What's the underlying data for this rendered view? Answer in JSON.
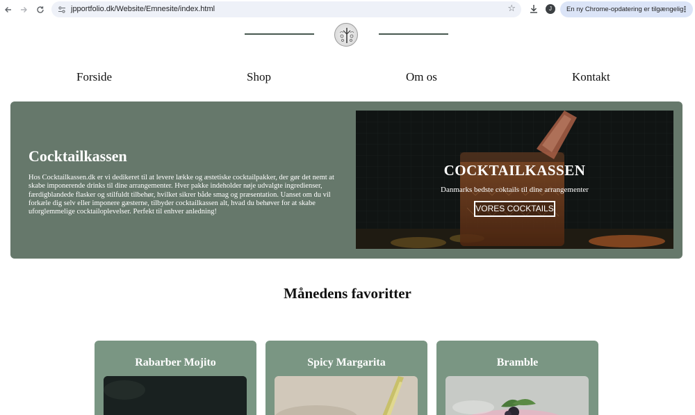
{
  "browser": {
    "url": "jpportfolio.dk/Website/Emnesite/index.html",
    "avatar_letter": "J",
    "update_notice": "En ny Chrome-opdatering er tilgængelig",
    "icons": [
      "back-arrow-icon",
      "forward-arrow-icon",
      "reload-icon",
      "site-info-icon",
      "bookmark-star-icon",
      "download-icon",
      "kebab-menu-icon"
    ]
  },
  "nav": {
    "items": [
      "Forside",
      "Shop",
      "Om os",
      "Kontakt"
    ]
  },
  "hero": {
    "title": "Cocktailkassen",
    "text": "Hos Cocktailkassen.dk er vi dedikeret til at levere lække og æstetiske cocktailpakker, der gør det nemt at skabe imponerende drinks til dine arrangementer. Hver pakke indeholder nøje udvalgte ingredienser, færdigblandede flasker og stilfuldt tilbehør, hvilket sikrer både smag og præsentation. Uanset om du vil forkæle dig selv eller imponere gæsterne, tilbyder cocktailkassen alt, hvad du behøver for at skabe uforglemmelige cocktailoplevelser. Perfekt til enhver anledning!",
    "banner_title": "COCKTAILKASSEN",
    "banner_subtitle": "Danmarks bedste coktails til dine arrangementer",
    "banner_button": "VORES COCKTAILS"
  },
  "favorites": {
    "title": "Månedens favoritter",
    "cards": [
      {
        "name": "Rabarber Mojito"
      },
      {
        "name": "Spicy Margarita"
      },
      {
        "name": "Bramble"
      }
    ]
  },
  "colors": {
    "hero_bg": "#66786b",
    "card_bg": "#7a9683",
    "header_line": "#46584f"
  }
}
